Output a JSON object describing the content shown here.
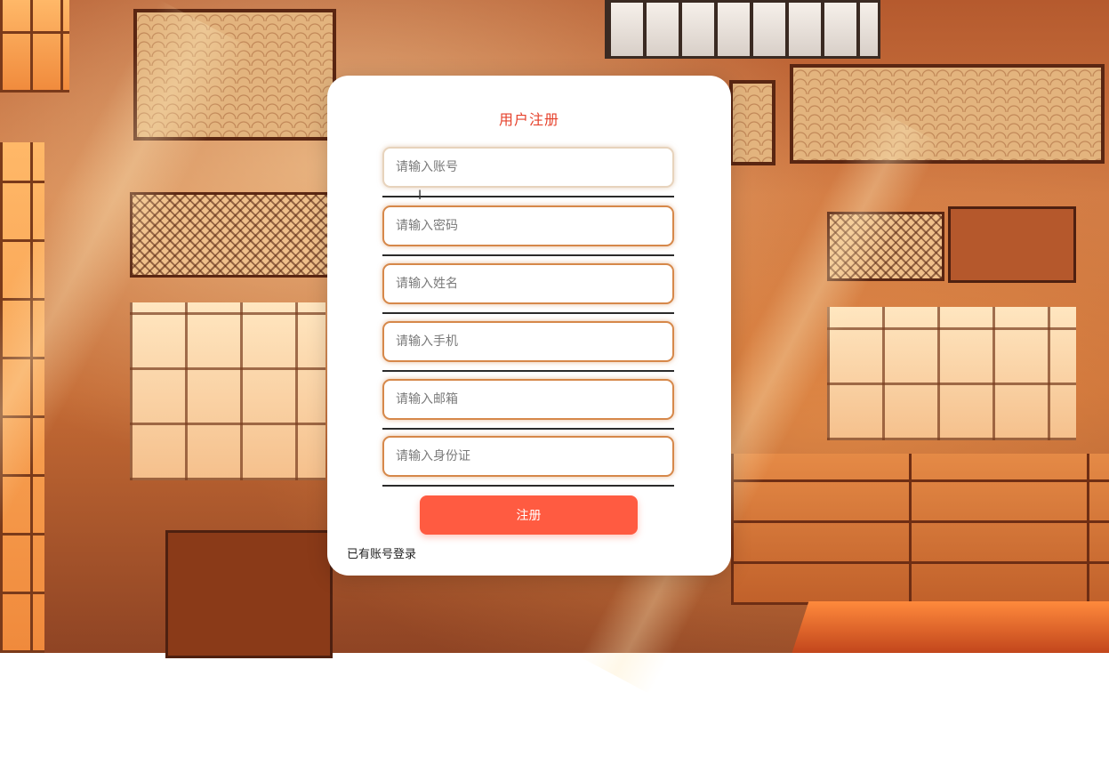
{
  "register_form": {
    "title": "用户注册",
    "fields": [
      {
        "name": "account",
        "placeholder": "请输入账号",
        "value": ""
      },
      {
        "name": "password",
        "placeholder": "请输入密码",
        "value": ""
      },
      {
        "name": "fullname",
        "placeholder": "请输入姓名",
        "value": ""
      },
      {
        "name": "phone",
        "placeholder": "请输入手机",
        "value": ""
      },
      {
        "name": "email",
        "placeholder": "请输入邮箱",
        "value": ""
      },
      {
        "name": "id_card",
        "placeholder": "请输入身份证",
        "value": ""
      }
    ],
    "submit_label": "注册",
    "login_link": "已有账号登录"
  },
  "theme": {
    "accent": "#ff5b41",
    "title_color": "#e6422c",
    "input_border": "#d6884a"
  }
}
